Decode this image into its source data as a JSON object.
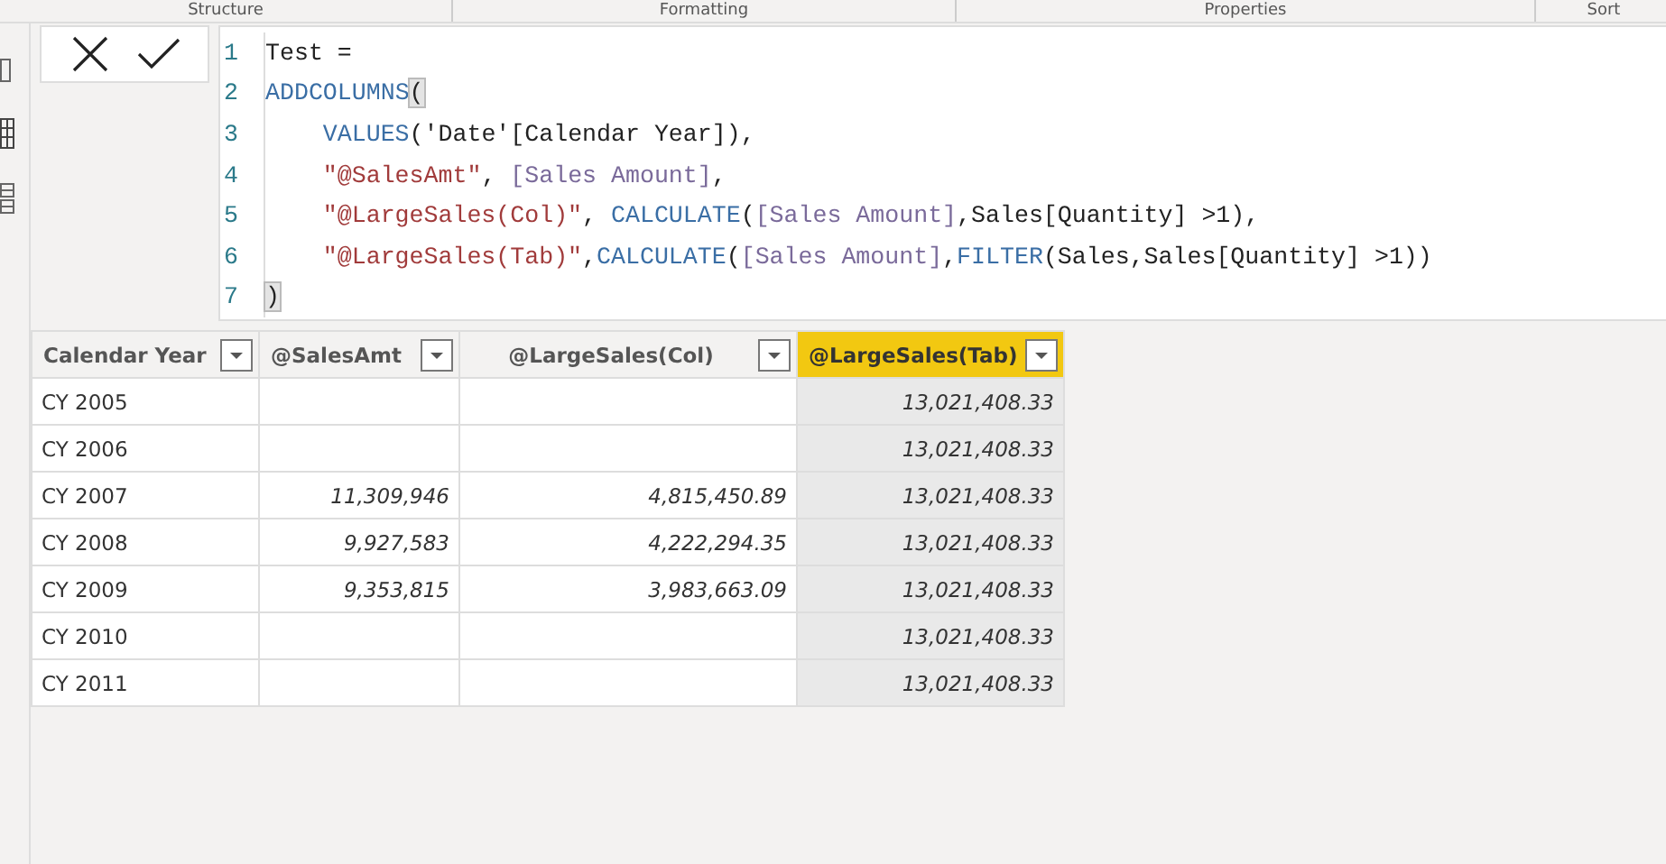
{
  "ribbon": {
    "groups": [
      "Structure",
      "Formatting",
      "Properties",
      "Sort"
    ]
  },
  "formula_bar": {
    "lines": [
      {
        "number": "1",
        "indented": false,
        "tokens": [
          {
            "kind": "plain",
            "text": "Test ="
          }
        ]
      },
      {
        "number": "2",
        "indented": false,
        "tokens": [
          {
            "kind": "keyword",
            "text": "ADDCOLUMNS"
          },
          {
            "kind": "bracket_match",
            "text": "("
          }
        ]
      },
      {
        "number": "3",
        "indented": true,
        "tokens": [
          {
            "kind": "keyword",
            "text": "VALUES"
          },
          {
            "kind": "plain",
            "text": "('Date'[Calendar Year]),"
          }
        ]
      },
      {
        "number": "4",
        "indented": true,
        "tokens": [
          {
            "kind": "string",
            "text": "\"@SalesAmt\""
          },
          {
            "kind": "plain",
            "text": ", "
          },
          {
            "kind": "measure",
            "text": "[Sales Amount]"
          },
          {
            "kind": "plain",
            "text": ","
          }
        ]
      },
      {
        "number": "5",
        "indented": true,
        "tokens": [
          {
            "kind": "string",
            "text": "\"@LargeSales(Col)\""
          },
          {
            "kind": "plain",
            "text": ", "
          },
          {
            "kind": "keyword",
            "text": "CALCULATE"
          },
          {
            "kind": "plain",
            "text": "("
          },
          {
            "kind": "measure",
            "text": "[Sales Amount]"
          },
          {
            "kind": "plain",
            "text": ",Sales[Quantity] >1),"
          }
        ]
      },
      {
        "number": "6",
        "indented": true,
        "tokens": [
          {
            "kind": "string",
            "text": "\"@LargeSales(Tab)\""
          },
          {
            "kind": "plain",
            "text": ","
          },
          {
            "kind": "keyword",
            "text": "CALCULATE"
          },
          {
            "kind": "plain",
            "text": "("
          },
          {
            "kind": "measure",
            "text": "[Sales Amount]"
          },
          {
            "kind": "plain",
            "text": ","
          },
          {
            "kind": "keyword",
            "text": "FILTER"
          },
          {
            "kind": "plain",
            "text": "(Sales,Sales[Quantity] >1))"
          }
        ]
      },
      {
        "number": "7",
        "indented": false,
        "tokens": [
          {
            "kind": "bracket_match",
            "text": ")"
          }
        ]
      }
    ]
  },
  "table": {
    "columns": [
      {
        "label": "Calendar Year",
        "selected": false
      },
      {
        "label": "@SalesAmt",
        "selected": false
      },
      {
        "label": "@LargeSales(Col)",
        "selected": false
      },
      {
        "label": "@LargeSales(Tab)",
        "selected": true
      }
    ],
    "rows": [
      [
        "CY 2005",
        null,
        null,
        "13,021,408.33"
      ],
      [
        "CY 2006",
        null,
        null,
        "13,021,408.33"
      ],
      [
        "CY 2007",
        "11,309,946",
        "4,815,450.89",
        "13,021,408.33"
      ],
      [
        "CY 2008",
        "9,927,583",
        "4,222,294.35",
        "13,021,408.33"
      ],
      [
        "CY 2009",
        "9,353,815",
        "3,983,663.09",
        "13,021,408.33"
      ],
      [
        "CY 2010",
        null,
        null,
        "13,021,408.33"
      ],
      [
        "CY 2011",
        null,
        null,
        "13,021,408.33"
      ]
    ]
  }
}
